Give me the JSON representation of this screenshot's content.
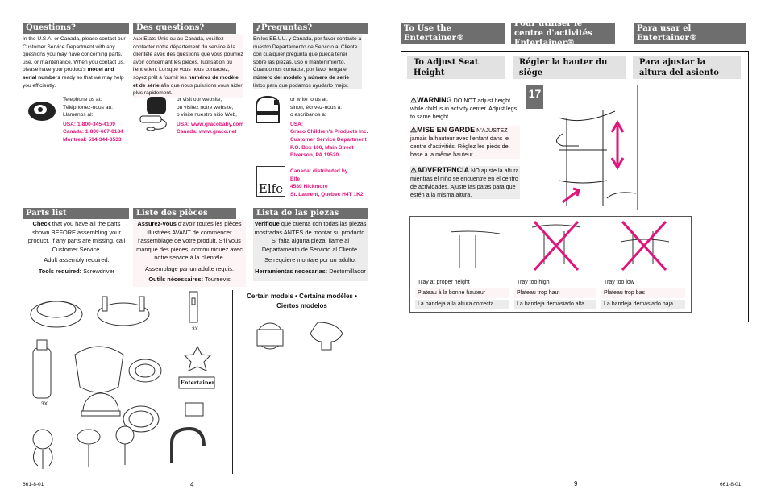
{
  "left_page": {
    "questions": [
      {
        "title": "Questions?",
        "body_pre": "In the U.S.A. or Canada, please contact our Customer Service Department with any questions you may have concerning parts, use, or maintenance. When you contact us, please have your product's ",
        "body_bold": "model and serial numbers",
        "body_post": " ready so that we may help you efficiently."
      },
      {
        "title": "Des questions?",
        "body_pre": "Aux Etats-Unis ou au Canada, veuillez contacter notre département du service à la clientèle avec des questions que vous pourriez avoir concernant les pièces, l'utilisation ou l'entretien. Lorsque vous nous contactez, soyez prêt à fournir les ",
        "body_bold": "numéros de modèle et de série",
        "body_post": " afin que nous puissions vous aider plus rapidement."
      },
      {
        "title": "¿Preguntas?",
        "body_pre": "En los EE.UU. y Canadá, por favor contacte a nuestro Departamento de Servicio al Cliente con cualquier pregunta que pueda tener sobre las piezas, uso o mantenimiento. Cuando nos contacte, por favor tenga el ",
        "body_bold": "número del modelo y número de serie",
        "body_post": " listos para que podamos ayudarlo mejor."
      }
    ],
    "contact": {
      "phone": {
        "lines": [
          "Telephone us at:",
          "Téléphonez-nous au:",
          "Llámenos al:"
        ],
        "numbers": [
          "USA: 1-800-345-4109",
          "Canada: 1-800-667-8184",
          "Montreal: 514-344-3533"
        ]
      },
      "web": {
        "lines": [
          "or visit our website,",
          "ou visitez notre website,",
          "o visite nuestro sitio Web,"
        ],
        "urls": [
          "USA: www.gracobaby.com",
          "Canada: www.graco.net"
        ]
      },
      "mail": {
        "lines": [
          "or write to us at:",
          "sinon, écrivez-nous à:",
          "o escribanos a:"
        ],
        "address": [
          "USA:",
          "Graco Children's Products Inc.",
          "Customer Service Department",
          "P.O. Box 100, Main Street",
          "Elverson, PA 19520"
        ]
      },
      "canada": {
        "logo": "Elfe",
        "address": [
          "Canada: distributed by",
          "Elfe",
          "4580 Hickmore",
          "St. Laurent, Quebec H4T 1K2"
        ]
      }
    },
    "parts": [
      {
        "title": "Parts list",
        "bold": "Check",
        "text": " that you have all the parts shown BEFORE assembling your product. If any parts are missing, call Customer Service.",
        "adult": "Adult assembly required.",
        "tools_label": "Tools required:",
        "tools": " Screwdriver"
      },
      {
        "title": "Liste des pièces",
        "bold": "Assurez-vous",
        "text": " d'avoir toutes les pièces illustrées AVANT de commencer l'assemblage de votre produit. S'il vous manque des pièces, communiquez avec notre service à la clientèle.",
        "adult": "Assemblage par un adulte requis.",
        "tools_label": "Outils nécessaires:",
        "tools": " Tournevis"
      },
      {
        "title": "Lista de las piezas",
        "bold": "Verifique",
        "text": " que cuenta con todas las piezas mostradas ANTES de montar su producto. Si falta alguna pieza, llame al Departamento de Servicio al Cliente.",
        "adult": "Se requiere montaje por un adulto.",
        "tools_label": "Herramientas necesarias:",
        "tools": " Destornillador"
      }
    ],
    "certain_models": "Certain models  •  Certains modèles  •  Ciertos modelos",
    "qty_3x_a": "3X",
    "qty_3x_b": "3X",
    "toy_label": "Entertainer",
    "footer_code": "661-8-01",
    "page_number": "4"
  },
  "right_page": {
    "headers": [
      "To Use the Entertainer®",
      "Pour utiliser le centre d'activités  Entertainer®",
      "Para usar el Entertainer®"
    ],
    "subheaders": [
      "To Adjust Seat Height",
      "Régler la hauter du siège",
      "Para ajustar la altura del asiento"
    ],
    "step": "17",
    "warnings": [
      {
        "key": "WARNING",
        "text": "DO NOT adjust height while child is in activity center. Adjust legs to same height."
      },
      {
        "key": "MISE EN GARDE",
        "text": "N'AJUSTEZ jamais la hauteur avec l'enfant dans le centre d'activitiés. Réglez les pieds de base à la même hauteur."
      },
      {
        "key": "ADVERTENCIA",
        "text": "NO ajuste la altura mientras el niño se encuentre en el centro de actividades. Ajuste las patas para que estén a la misma altura."
      }
    ],
    "tray": [
      {
        "en": "Tray at proper height",
        "fr": "Plateau à la bonne hauteur",
        "es": "La bandeja a la altura correcta"
      },
      {
        "en": "Tray too high",
        "fr": "Plateau trop haut",
        "es": "La bandeja demasiado alta"
      },
      {
        "en": "Tray too low",
        "fr": "Plateau trop bas",
        "es": "La bandeja demasiado baja"
      }
    ],
    "page_number": "9",
    "footer_code": "661-8-01"
  },
  "colors": {
    "header_bar": "#6e6e6e",
    "accent": "#e0147a",
    "subheader": "#e2e2e2"
  }
}
